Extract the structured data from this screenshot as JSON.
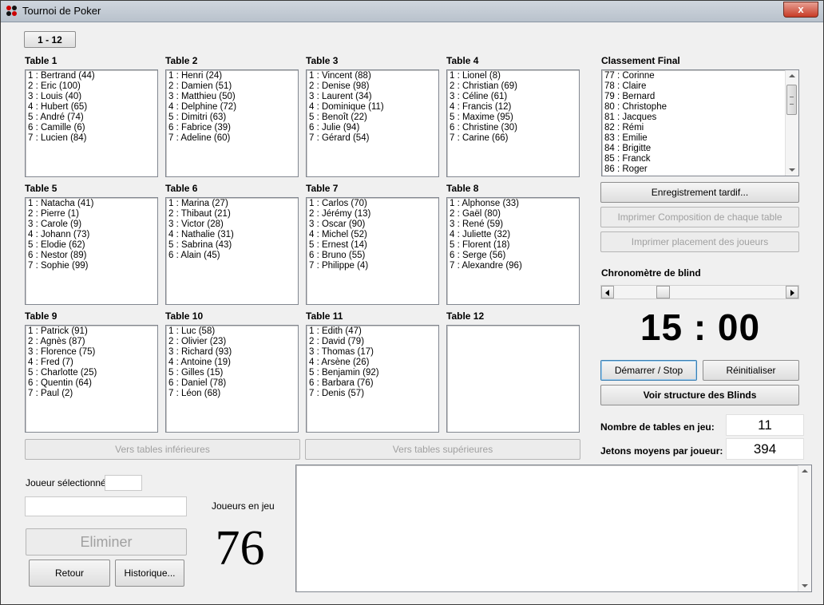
{
  "window": {
    "title": "Tournoi de Poker",
    "close_label": "x"
  },
  "tab_button": "1 - 12",
  "tables": [
    {
      "name": "Table 1",
      "players": [
        "1 : Bertrand (44)",
        "2 : Eric (100)",
        "3 : Louis (40)",
        "4 : Hubert (65)",
        "5 : André (74)",
        "6 : Camille (6)",
        "7 : Lucien (84)"
      ]
    },
    {
      "name": "Table 2",
      "players": [
        "1 : Henri (24)",
        "2 : Damien (51)",
        "3 : Matthieu (50)",
        "4 : Delphine (72)",
        "5 : Dimitri (63)",
        "6 : Fabrice (39)",
        "7 : Adeline (60)"
      ]
    },
    {
      "name": "Table 3",
      "players": [
        "1 : Vincent (88)",
        "2 : Denise (98)",
        "3 : Laurent (34)",
        "4 : Dominique (11)",
        "5 : Benoît (22)",
        "6 : Julie (94)",
        "7 : Gérard (54)"
      ]
    },
    {
      "name": "Table 4",
      "players": [
        "1 : Lionel (8)",
        "2 : Christian (69)",
        "3 : Céline (61)",
        "4 : Francis (12)",
        "5 : Maxime (95)",
        "6 : Christine (30)",
        "7 : Carine (66)"
      ]
    },
    {
      "name": "Table 5",
      "players": [
        "1 : Natacha (41)",
        "2 : Pierre (1)",
        "3 : Carole (9)",
        "4 : Johann (73)",
        "5 : Elodie (62)",
        "6 : Nestor (89)",
        "7 : Sophie (99)"
      ]
    },
    {
      "name": "Table 6",
      "players": [
        "1 : Marina (27)",
        "2 : Thibaut (21)",
        "3 : Victor (28)",
        "4 : Nathalie (31)",
        "5 : Sabrina (43)",
        "6 : Alain (45)"
      ]
    },
    {
      "name": "Table 7",
      "players": [
        "1 : Carlos (70)",
        "2 : Jérémy (13)",
        "3 : Oscar (90)",
        "4 : Michel (52)",
        "5 : Ernest (14)",
        "6 : Bruno (55)",
        "7 : Philippe (4)"
      ]
    },
    {
      "name": "Table 8",
      "players": [
        "1 : Alphonse (33)",
        "2 : Gaël (80)",
        "3 : René (59)",
        "4 : Juliette (32)",
        "5 : Florent (18)",
        "6 : Serge (56)",
        "7 : Alexandre (96)"
      ]
    },
    {
      "name": "Table 9",
      "players": [
        "1 : Patrick (91)",
        "2 : Agnès (87)",
        "3 : Florence (75)",
        "4 : Fred (7)",
        "5 : Charlotte (25)",
        "6 : Quentin (64)",
        "7 : Paul (2)"
      ]
    },
    {
      "name": "Table 10",
      "players": [
        "1 : Luc (58)",
        "2 : Olivier (23)",
        "3 : Richard (93)",
        "4 : Antoine (19)",
        "5 : Gilles (15)",
        "6 : Daniel (78)",
        "7 : Léon (68)"
      ]
    },
    {
      "name": "Table 11",
      "players": [
        "1 : Edith (47)",
        "2 : David (79)",
        "3 : Thomas (17)",
        "4 : Arsène (26)",
        "5 : Benjamin (92)",
        "6 : Barbara (76)",
        "7 : Denis (57)"
      ]
    },
    {
      "name": "Table 12",
      "players": []
    }
  ],
  "classement": {
    "label": "Classement Final",
    "items": [
      "77 : Corinne",
      "78 : Claire",
      "79 : Bernard",
      "80 : Christophe",
      "81 : Jacques",
      "82 : Rémi",
      "83 : Emilie",
      "84 : Brigitte",
      "85 : Franck",
      "86 : Roger"
    ]
  },
  "buttons": {
    "enregistrement": "Enregistrement tardif...",
    "imprimer_composition": "Imprimer Composition de chaque table",
    "imprimer_placement": "Imprimer placement des joueurs",
    "demarrer": "Démarrer / Stop",
    "reinitialiser": "Réinitialiser",
    "voir_structure": "Voir structure des Blinds",
    "vers_inferieures": "Vers tables inférieures",
    "vers_superieures": "Vers tables supérieures",
    "eliminer": "Eliminer",
    "retour": "Retour",
    "historique": "Historique..."
  },
  "chrono": {
    "label": "Chronomètre de blind",
    "time": "15 : 00",
    "slider_level": 0.27
  },
  "stats": {
    "tables_label": "Nombre de tables en jeu:",
    "tables_value": "11",
    "jetons_label": "Jetons moyens par joueur:",
    "jetons_value": "394"
  },
  "joueur": {
    "selected_label": "Joueur sélectionné:",
    "selected_value": "",
    "name_value": ""
  },
  "en_jeu": {
    "label": "Joueurs en jeu",
    "count": "76"
  },
  "colors": {
    "accent": "#3c7fb1",
    "close_red": "#c73b26",
    "disabled_text": "#a0a0a0"
  }
}
